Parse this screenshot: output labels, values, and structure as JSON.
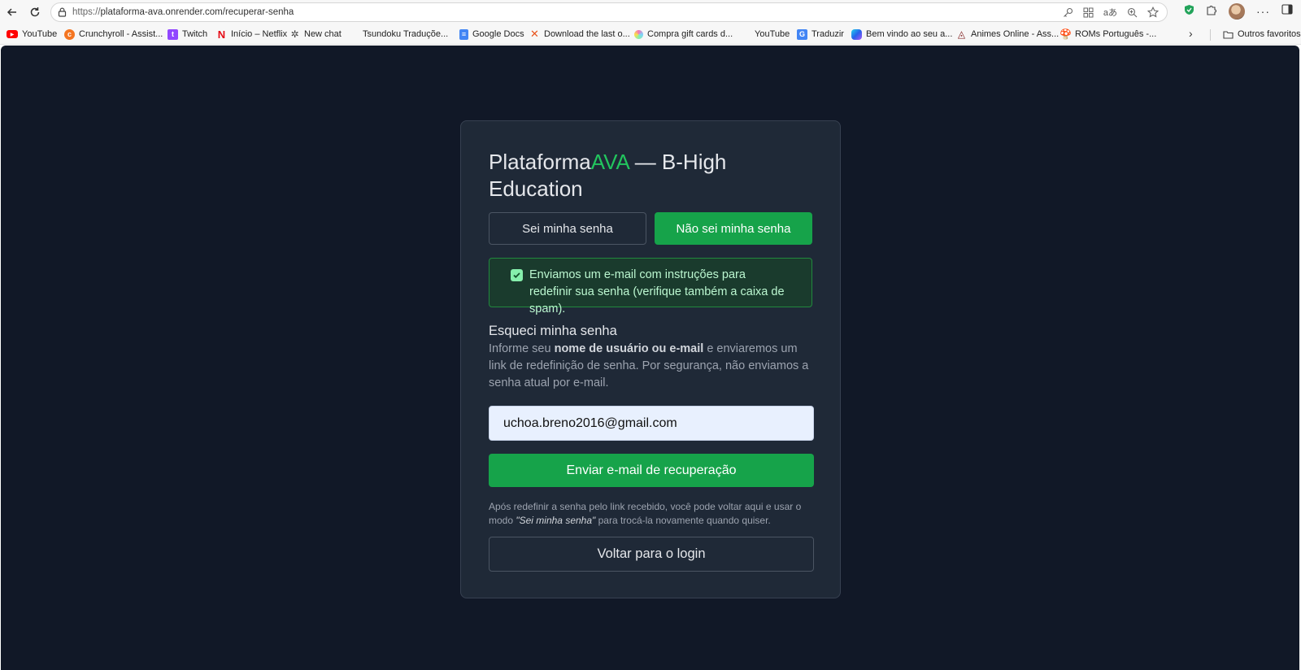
{
  "browser": {
    "url_prefix": "https://",
    "url_main": "plataforma-ava.onrender.com/recuperar-senha",
    "bookmarks": [
      {
        "label": "YouTube",
        "icon": "youtube-icon",
        "color": "#ff0000"
      },
      {
        "label": "Crunchyroll - Assist...",
        "icon": "crunchyroll-icon",
        "color": "#f47521"
      },
      {
        "label": "Twitch",
        "icon": "twitch-icon",
        "color": "#9146ff"
      },
      {
        "label": "Início – Netflix",
        "icon": "netflix-icon",
        "color": "#e50914"
      },
      {
        "label": "New chat",
        "icon": "chatgpt-icon",
        "color": "#444444"
      },
      {
        "label": "Tsundoku Traduçõe...",
        "icon": "tsundoku-icon",
        "color": "#f7f7f7"
      },
      {
        "label": "Google Docs",
        "icon": "google-docs-icon",
        "color": "#4285f4"
      },
      {
        "label": "Download the last o...",
        "icon": "x-icon",
        "color": "#e8541e"
      },
      {
        "label": "Compra gift cards d...",
        "icon": "giftcard-icon",
        "color": "#7dd3fc"
      },
      {
        "label": "YouTube",
        "icon": "youtube-blank-icon",
        "color": "#f7f7f7"
      },
      {
        "label": "Traduzir",
        "icon": "translate-icon",
        "color": "#4285f4"
      },
      {
        "label": "Bem vindo ao seu a...",
        "icon": "copilot-icon",
        "color": "#2563eb"
      },
      {
        "label": "Animes Online - Ass...",
        "icon": "animes-icon",
        "color": "#b91c1c"
      },
      {
        "label": "ROMs Português -...",
        "icon": "roms-icon",
        "color": "#92400e"
      }
    ],
    "other_favorites": "Outros favoritos"
  },
  "page": {
    "title_prefix": "Plataforma",
    "title_accent": "AVA",
    "title_suffix": " — B-High Education",
    "mode_known": "Sei minha senha",
    "mode_unknown": "Não sei minha senha",
    "alert_message": "Enviamos um e-mail com instruções para redefinir sua senha (verifique também a caixa de spam).",
    "section_title": "Esqueci minha senha",
    "help_before": "Informe seu ",
    "help_bold": "nome de usuário ou e-mail",
    "help_after": " e enviaremos um link de redefinição de senha. Por segurança, não enviamos a senha atual por e-mail.",
    "email_value": "uchoa.breno2016@gmail.com",
    "submit_label": "Enviar e-mail de recuperação",
    "note_before": "Após redefinir a senha pelo link recebido, você pode voltar aqui e usar o modo ",
    "note_italic": "\"Sei minha senha\"",
    "note_after": " para trocá-la novamente quando quiser.",
    "back_label": "Voltar para o login"
  },
  "colors": {
    "page_bg": "#111827",
    "card_bg": "#1f2937",
    "accent": "#22c55e",
    "button_green": "#16a34a"
  }
}
